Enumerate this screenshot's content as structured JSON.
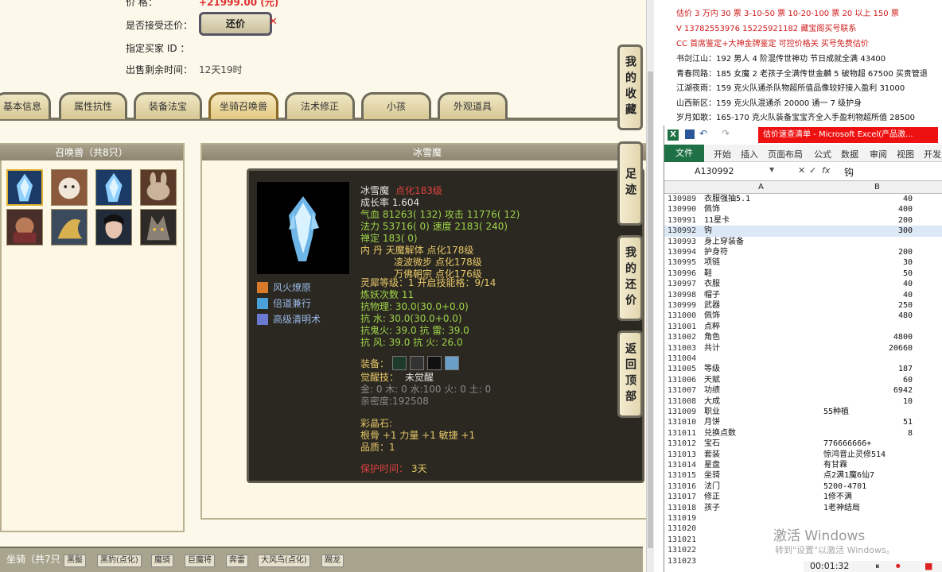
{
  "game": {
    "price_label": "价      格：",
    "price_value": "+21999.00 (元)",
    "accept_bargain_label": "是否接受还价：",
    "bargain_button": "还价",
    "bargain_x": "✕",
    "buyer_label": "指定买家 ID ：",
    "remaining_label": "出售剩余时间：",
    "remaining_value": "12天19时",
    "tabs": [
      {
        "label": "基本信息"
      },
      {
        "label": "属性抗性"
      },
      {
        "label": "装备法宝"
      },
      {
        "label": "坐骑召唤兽"
      },
      {
        "label": "法术修正"
      },
      {
        "label": "小孩"
      },
      {
        "label": "外观道具"
      }
    ],
    "pets_header": "召唤兽（共8只）",
    "detail_header": "冰雪魔",
    "side_buttons": [
      {
        "label": "我的收藏"
      },
      {
        "label": "足迹"
      },
      {
        "label": "我的还价"
      },
      {
        "label": "返回顶部"
      }
    ],
    "tip": {
      "name": "冰雪魔",
      "level": "点化183级",
      "growth": "成长率 1.604",
      "hp": "气血 81263( 132) 攻击 11776( 12)",
      "mp": "法力 53716( 0) 速度 2183( 240)",
      "ding": "禅定 183( 0)",
      "neidan1": "内    丹 天魔解体 点化178级",
      "neidan2": "凌波微步 点化178级",
      "neidan3": "万佛朝宗 点化176级",
      "skills": [
        {
          "name": "风火燎原"
        },
        {
          "name": "倍道兼行"
        },
        {
          "name": "高级清明术"
        }
      ],
      "spirit": "灵犀等级：1 开启技能格：9/14",
      "refine": "炼妖次数 11",
      "res1": "抗物理: 30.0(30.0+0.0)",
      "res2": "抗    水: 30.0(30.0+0.0)",
      "res3": "抗鬼火: 39.0 抗    雷: 39.0",
      "res4": "抗    风: 39.0 抗    火: 26.0",
      "equip": "装备：",
      "awaken_label": "觉醒技：",
      "awaken_value": "未觉醒",
      "elements": "金: 0 木: 0 水:100 火: 0 土: 0",
      "intimacy": "亲密度:192508",
      "gem_label": "彩晶石:",
      "gem_value": "根骨 +1 力量 +1 敏捷 +1",
      "quality": "品质：1",
      "protect_label": "保护时间：",
      "protect_value": "3天"
    },
    "mount_bar": {
      "title": "坐骑（共7只",
      "items": [
        {
          "label": "黑鬃"
        },
        {
          "label": "黑豹(点化)"
        },
        {
          "label": "魔骑"
        },
        {
          "label": "巨魔将"
        },
        {
          "label": "奔雷"
        },
        {
          "label": "大风鸟(点化)"
        },
        {
          "label": "踢龙"
        }
      ]
    }
  },
  "notes": {
    "lines": [
      {
        "text": "估价 3 万内 30 票   3-10-50 票    10-20-100 票    20 以上 150 票",
        "color": "red"
      },
      {
        "text": "V 13782553976     15225921182    藏宝阁买号联系",
        "color": "red"
      },
      {
        "text": "CC 首席鉴定+大神金牌鉴定  可控价格关  买号免费估价",
        "color": "red"
      },
      {
        "text": "书剑江山：192 男人 4 阶混传世神功  节日成就全满 43400",
        "color": "black"
      },
      {
        "text": "青春同路：185 女魔 2 老孩子全满传世金麟 5 破物超 67500 买贵管退",
        "color": "black"
      },
      {
        "text": "江湖夜雨：159 克火队通杀队物超所值品像较好接入盈利 31000",
        "color": "black"
      },
      {
        "text": "山西新区：159 克火队混通杀 20000 通一 7 级护身",
        "color": "black"
      },
      {
        "text": "岁月如歌：165-170 克火队装备宝宝齐全入手盈利物超所值 28500",
        "color": "black"
      }
    ]
  },
  "excel": {
    "title": "估价速查清单 - Microsoft Excel(产品激...",
    "ribbon": [
      "开始",
      "插入",
      "页面布局",
      "公式",
      "数据",
      "审阅",
      "视图",
      "开发"
    ],
    "file_tab": "文件",
    "namebox": "A130992",
    "formula": "钩",
    "col_a": "A",
    "col_b": "B",
    "rows": [
      {
        "n": "130989",
        "a": "衣服强抽5.1",
        "b": "40"
      },
      {
        "n": "130990",
        "a": "佩饰",
        "b": "400"
      },
      {
        "n": "130991",
        "a": "11星卡",
        "b": "200"
      },
      {
        "n": "130992",
        "a": "钩",
        "b": "300"
      },
      {
        "n": "130993",
        "a": "身上穿装备",
        "b": ""
      },
      {
        "n": "130994",
        "a": "护身符",
        "b": "200"
      },
      {
        "n": "130995",
        "a": "项链",
        "b": "30"
      },
      {
        "n": "130996",
        "a": "鞋",
        "b": "50"
      },
      {
        "n": "130997",
        "a": "衣服",
        "b": "40"
      },
      {
        "n": "130998",
        "a": "帽子",
        "b": "40"
      },
      {
        "n": "130999",
        "a": "武器",
        "b": "250"
      },
      {
        "n": "131000",
        "a": "佩饰",
        "b": "480"
      },
      {
        "n": "131001",
        "a": "点粹",
        "b": ""
      },
      {
        "n": "131002",
        "a": "角色",
        "b": "4800"
      },
      {
        "n": "131003",
        "a": "共计",
        "b": "20660"
      },
      {
        "n": "131004",
        "a": "",
        "b": ""
      },
      {
        "n": "131005",
        "a": "等级",
        "b": "187"
      },
      {
        "n": "131006",
        "a": "天赋",
        "b": "60"
      },
      {
        "n": "131007",
        "a": "功绩",
        "b": "6942"
      },
      {
        "n": "131008",
        "a": "大成",
        "b": "10"
      },
      {
        "n": "131009",
        "a": "职业",
        "bl": "55种植"
      },
      {
        "n": "131010",
        "a": "月饼",
        "b": "51"
      },
      {
        "n": "131011",
        "a": "兑换点数",
        "b": "8"
      },
      {
        "n": "131012",
        "a": "宝石",
        "bl": "776666666+"
      },
      {
        "n": "131013",
        "a": "套装",
        "bl": "惊鸿音止灵修514"
      },
      {
        "n": "131014",
        "a": "星盘",
        "bl": "有甘霖"
      },
      {
        "n": "131015",
        "a": "坐骑",
        "bl": "点2满1魔6仙7"
      },
      {
        "n": "131016",
        "a": "法门",
        "bl": "5200-4701"
      },
      {
        "n": "131017",
        "a": "修正",
        "bl": "1修不满"
      },
      {
        "n": "131018",
        "a": "孩子",
        "bl": "1老神结局"
      },
      {
        "n": "131019",
        "a": "",
        "b": ""
      },
      {
        "n": "131020",
        "a": "",
        "b": ""
      },
      {
        "n": "131021",
        "a": "",
        "b": ""
      },
      {
        "n": "131022",
        "a": "",
        "b": ""
      },
      {
        "n": "131023",
        "a": "",
        "b": ""
      }
    ]
  },
  "watermark": {
    "line1": "激活 Windows",
    "line2": "转到\"设置\"以激活 Windows。"
  },
  "recorder": {
    "time": "00:01:32"
  }
}
